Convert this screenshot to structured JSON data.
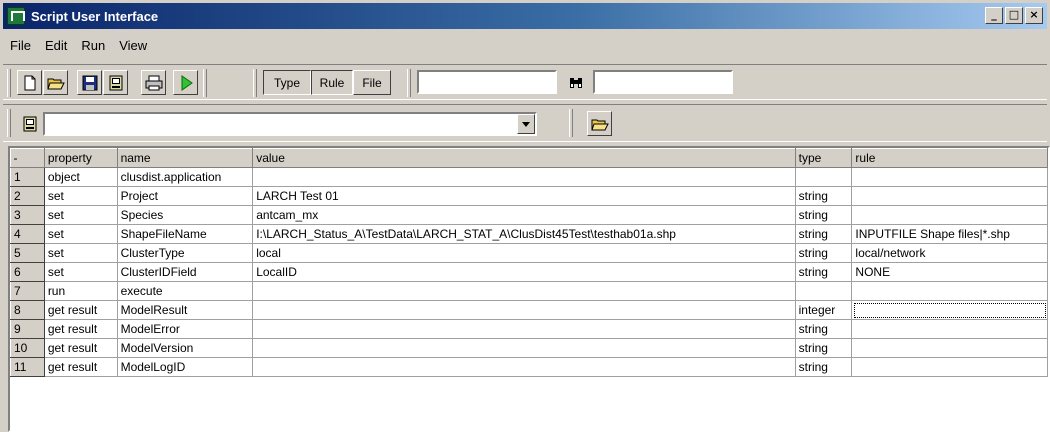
{
  "window": {
    "title": "Script User Interface",
    "minimize": "_",
    "maximize": "□",
    "close": "×"
  },
  "menu": [
    "File",
    "Edit",
    "Run",
    "View"
  ],
  "toolbar": {
    "segments": [
      "Type",
      "Rule",
      "File"
    ],
    "search_value": "",
    "second_value": "",
    "script_select_value": ""
  },
  "table": {
    "headers": [
      "-",
      "property",
      "name",
      "value",
      "type",
      "rule"
    ],
    "rows": [
      [
        "1",
        "object",
        "clusdist.application",
        "",
        "",
        ""
      ],
      [
        "2",
        "set",
        "Project",
        "LARCH Test 01",
        "string",
        ""
      ],
      [
        "3",
        "set",
        "Species",
        "antcam_mx",
        "string",
        ""
      ],
      [
        "4",
        "set",
        "ShapeFileName",
        "I:\\LARCH_Status_A\\TestData\\LARCH_STAT_A\\ClusDist45Test\\testhab01a.shp",
        "string",
        "INPUTFILE Shape files|*.shp"
      ],
      [
        "5",
        "set",
        "ClusterType",
        "local",
        "string",
        "local/network"
      ],
      [
        "6",
        "set",
        "ClusterIDField",
        "LocalID",
        "string",
        "NONE"
      ],
      [
        "7",
        "run",
        "execute",
        "",
        "",
        ""
      ],
      [
        "8",
        "get result",
        "ModelResult",
        "",
        "integer",
        ""
      ],
      [
        "9",
        "get result",
        "ModelError",
        "",
        "string",
        ""
      ],
      [
        "10",
        "get result",
        "ModelVersion",
        "",
        "string",
        ""
      ],
      [
        "11",
        "get result",
        "ModelLogID",
        "",
        "string",
        ""
      ]
    ]
  }
}
